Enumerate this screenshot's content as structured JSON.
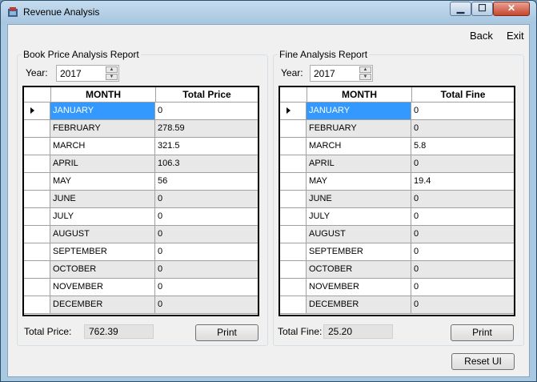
{
  "window": {
    "title": "Revenue Analysis",
    "minimize": "▁",
    "maximize": "☐",
    "close": "✕"
  },
  "menu": {
    "back": "Back",
    "exit": "Exit"
  },
  "book": {
    "group_title": "Book Price Analysis Report",
    "year_label": "Year:",
    "year_value": "2017",
    "col_month": "MONTH",
    "col_total": "Total Price",
    "rows": [
      {
        "month": "JANUARY",
        "value": "0"
      },
      {
        "month": "FEBRUARY",
        "value": "278.59"
      },
      {
        "month": "MARCH",
        "value": "321.5"
      },
      {
        "month": "APRIL",
        "value": "106.3"
      },
      {
        "month": "MAY",
        "value": "56"
      },
      {
        "month": "JUNE",
        "value": "0"
      },
      {
        "month": "JULY",
        "value": "0"
      },
      {
        "month": "AUGUST",
        "value": "0"
      },
      {
        "month": "SEPTEMBER",
        "value": "0"
      },
      {
        "month": "OCTOBER",
        "value": "0"
      },
      {
        "month": "NOVEMBER",
        "value": "0"
      },
      {
        "month": "DECEMBER",
        "value": "0"
      }
    ],
    "total_label": "Total Price:",
    "total_value": "762.39",
    "print_label": "Print"
  },
  "fine": {
    "group_title": "Fine Analysis Report",
    "year_label": "Year:",
    "year_value": "2017",
    "col_month": "MONTH",
    "col_total": "Total Fine",
    "rows": [
      {
        "month": "JANUARY",
        "value": "0"
      },
      {
        "month": "FEBRUARY",
        "value": "0"
      },
      {
        "month": "MARCH",
        "value": "5.8"
      },
      {
        "month": "APRIL",
        "value": "0"
      },
      {
        "month": "MAY",
        "value": "19.4"
      },
      {
        "month": "JUNE",
        "value": "0"
      },
      {
        "month": "JULY",
        "value": "0"
      },
      {
        "month": "AUGUST",
        "value": "0"
      },
      {
        "month": "SEPTEMBER",
        "value": "0"
      },
      {
        "month": "OCTOBER",
        "value": "0"
      },
      {
        "month": "NOVEMBER",
        "value": "0"
      },
      {
        "month": "DECEMBER",
        "value": "0"
      }
    ],
    "total_label": "Total Fine:",
    "total_value": "25.20",
    "print_label": "Print"
  },
  "reset_label": "Reset UI",
  "colors": {
    "selection": "#3399ff",
    "alt_row": "#e8e8e8",
    "frame": "#a9c8e1"
  }
}
